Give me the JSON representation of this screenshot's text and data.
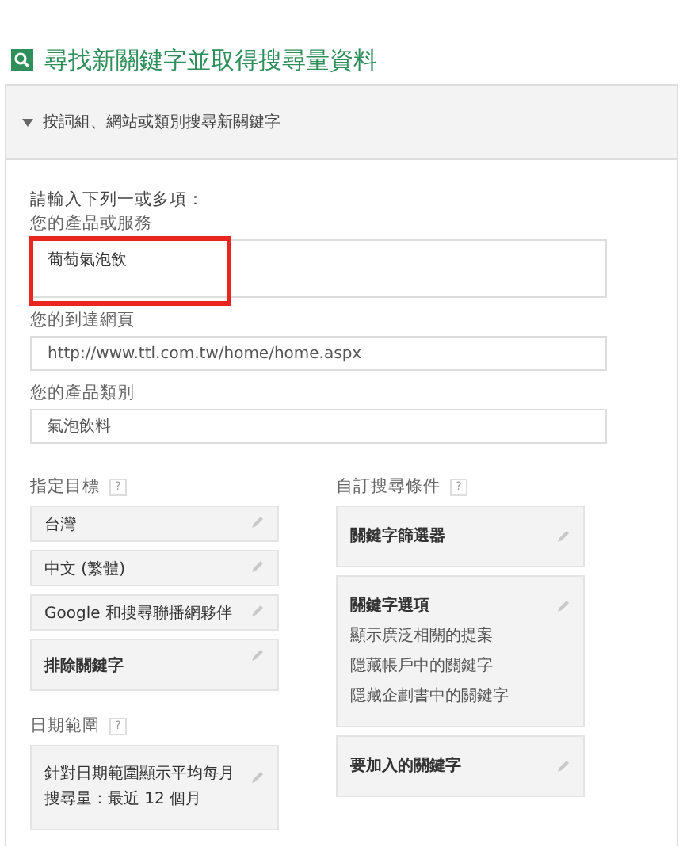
{
  "title": "尋找新關鍵字並取得搜尋量資料",
  "section": {
    "label": "按詞組、網站或類別搜尋新關鍵字",
    "expanded": true
  },
  "intro": "請輸入下列一或多項：",
  "fields": [
    {
      "label": "您的產品或服務",
      "value": "葡萄氣泡飲",
      "kind": "area",
      "highlighted": true
    },
    {
      "label": "您的到達網頁",
      "value": "http://www.ttl.com.tw/home/home.aspx",
      "kind": "line",
      "highlighted": false
    },
    {
      "label": "您的產品類別",
      "value": "氣泡飲料",
      "kind": "line",
      "highlighted": false
    }
  ],
  "targeting": {
    "label": "指定目標",
    "help": "?",
    "items": [
      {
        "text": "台灣",
        "bold": false
      },
      {
        "text": "中文 (繁體)",
        "bold": false
      },
      {
        "text": "Google 和搜尋聯播網夥伴",
        "bold": false
      },
      {
        "text": "排除關鍵字",
        "bold": true
      }
    ]
  },
  "date_range": {
    "label": "日期範圍",
    "help": "?",
    "text": "針對日期範圍顯示平均每月搜尋量：最近 12 個月"
  },
  "custom": {
    "label": "自訂搜尋條件",
    "help": "?",
    "items": [
      {
        "title": "關鍵字篩選器"
      },
      {
        "title": "關鍵字選項",
        "lines": [
          "顯示廣泛相關的提案",
          "隱藏帳戶中的關鍵字",
          "隱藏企劃書中的關鍵字"
        ]
      },
      {
        "title": "要加入的關鍵字"
      }
    ]
  }
}
